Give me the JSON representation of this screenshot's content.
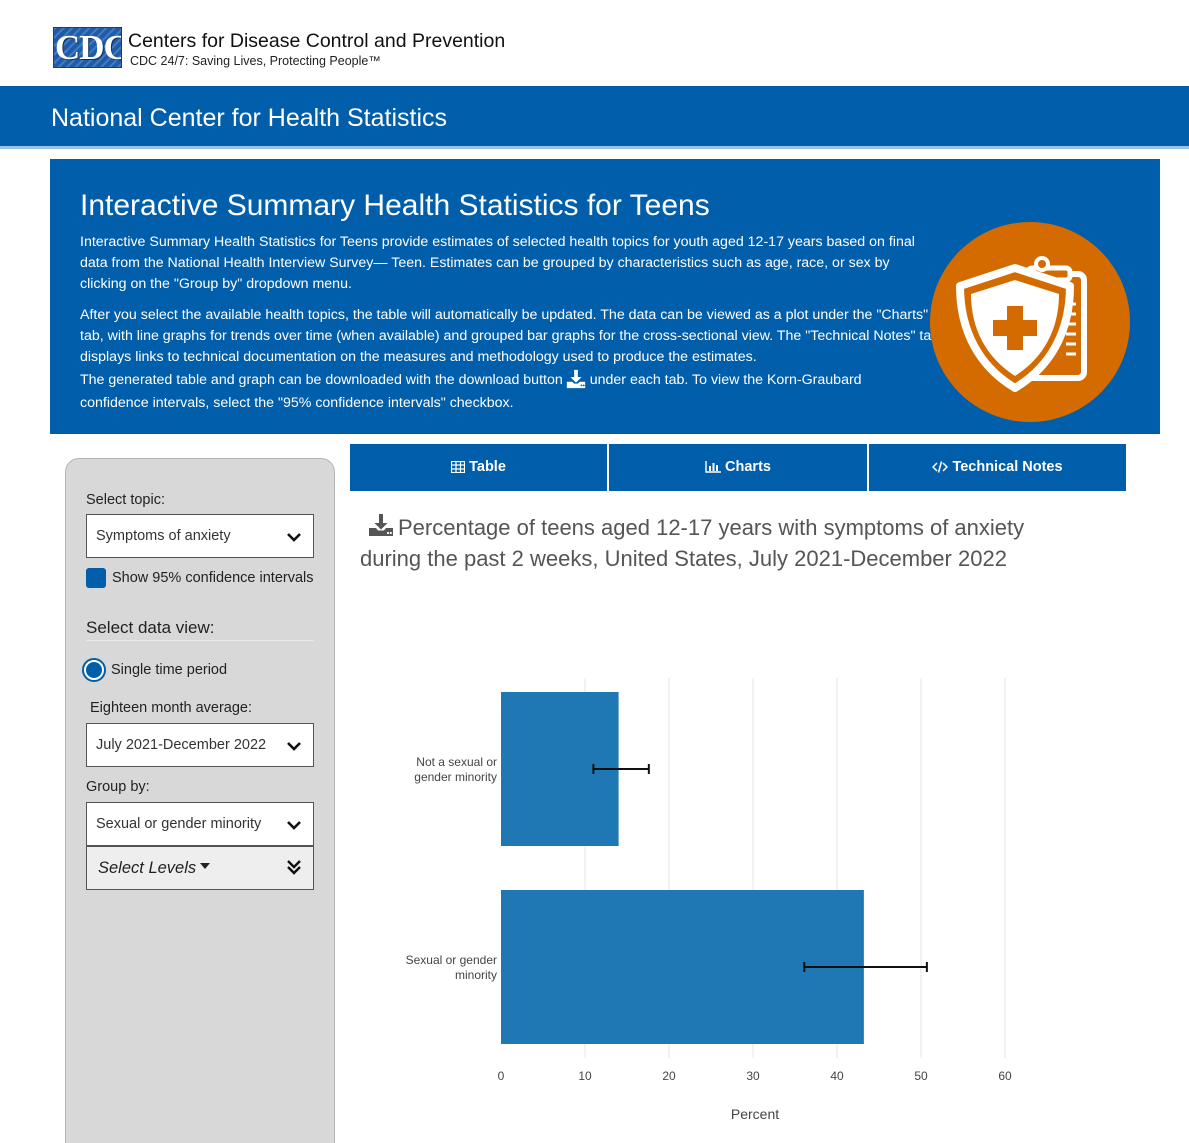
{
  "header": {
    "logo_text": "CDC",
    "org_name": "Centers for Disease Control and Prevention",
    "tagline": "CDC 24/7: Saving Lives, Protecting People™"
  },
  "nchs": {
    "title": "National Center for Health Statistics"
  },
  "hero": {
    "title": "Interactive Summary Health Statistics for Teens",
    "p1": "Interactive Summary Health Statistics for Teens provide estimates of selected health topics for youth aged 12-17 years based on final data from the National Health Interview Survey— Teen. Estimates can be grouped by characteristics such as age, race, or sex by clicking on the \"Group by\" dropdown menu.",
    "p2": "After you select the available health topics, the table will automatically be updated. The data can be viewed as a plot under the \"Charts\" tab, with line graphs for trends over time (when available) and grouped bar graphs for the cross-sectional view. The \"Technical Notes\" tab displays links to technical documentation on the measures and methodology used to produce the estimates.",
    "p3a": "The generated table and graph can be downloaded with the download button",
    "p3b": "under each tab. To view the Korn-Graubard",
    "p4": "confidence intervals, select the \"95% confidence intervals\" checkbox.",
    "badge_icon": "shield-clipboard-medical-icon",
    "badge_color": "#d36b00"
  },
  "sidebar": {
    "topic_label": "Select topic:",
    "topic_value": "Symptoms of anxiety",
    "ci_label": "Show 95% confidence intervals",
    "data_view_label": "Select data view:",
    "single_period_label": "Single time period",
    "eighteen_label": "Eighteen month average:",
    "eighteen_value": "July 2021-December 2022",
    "group_by_label": "Group by:",
    "group_by_value": "Sexual or gender minority",
    "levels_label": "Select Levels"
  },
  "tabs": [
    {
      "label": "Table",
      "icon": "table-icon"
    },
    {
      "label": "Charts",
      "icon": "bar-chart-icon"
    },
    {
      "label": "Technical Notes",
      "icon": "code-icon"
    }
  ],
  "colors": {
    "primary": "#005eaa",
    "bar": "#1f77b4",
    "badge": "#d36b00"
  },
  "chart_data": {
    "type": "bar",
    "orientation": "horizontal",
    "title": "Percentage of teens aged 12-17 years with symptoms of anxiety during the past 2 weeks, United States, July 2021-December 2022",
    "categories": [
      [
        "Not a sexual or",
        "gender minority"
      ],
      [
        "Sexual or gender",
        "minority"
      ]
    ],
    "values": [
      14.0,
      43.2
    ],
    "ci_low": [
      11.0,
      36.1
    ],
    "ci_high": [
      17.6,
      50.7
    ],
    "xlabel": "Percent",
    "xlim": [
      0,
      60
    ],
    "xticks": [
      0,
      10,
      20,
      30,
      40,
      50,
      60
    ],
    "grid": true,
    "bar_color": "#1f77b4"
  }
}
